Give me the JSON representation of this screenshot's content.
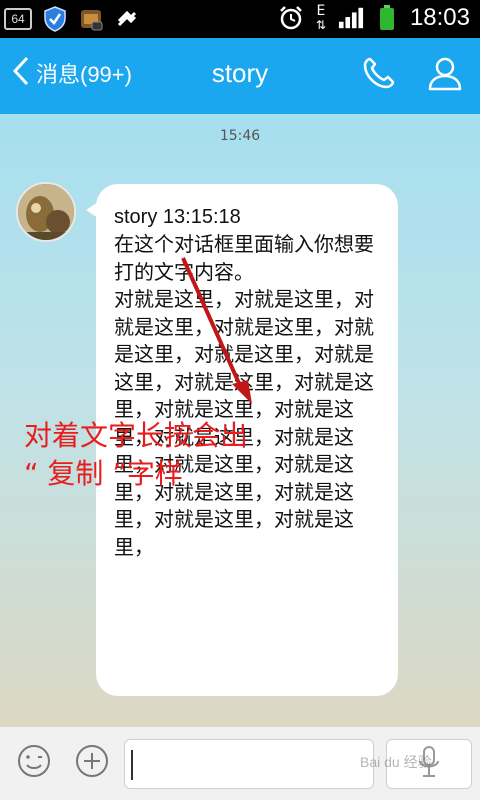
{
  "status_bar": {
    "badge": "64",
    "network_label": "E",
    "time": "18:03"
  },
  "header": {
    "back_label": "消息(99+)",
    "title": "story",
    "call_icon": "phone-icon",
    "profile_icon": "person-icon",
    "bg_color": "#1aa7ef"
  },
  "chat": {
    "timestamp": "15:46",
    "message": {
      "sender_time": "story 13:15:18",
      "text": "在这个对话框里面输入你想要打的文字内容。\n对就是这里，对就是这里，对就是这里，对就是这里，对就是这里，对就是这里，对就是这里，对就是这里，对就是这里，对就是这里，对就是这里，对就是这里，对就是这里，对就是这里，对就是这里，对就是这里，对就是这里，对就是这里，对就是这里，"
    },
    "annotation": {
      "line1": "对着文字长按会出",
      "line2": "“ 复制 ”字样",
      "color": "#e81e1e"
    }
  },
  "input_bar": {
    "emoji_icon": "emoji-icon",
    "plus_icon": "plus-icon",
    "voice_icon": "microphone-icon",
    "input_value": ""
  },
  "watermark": "Bai du 经验"
}
